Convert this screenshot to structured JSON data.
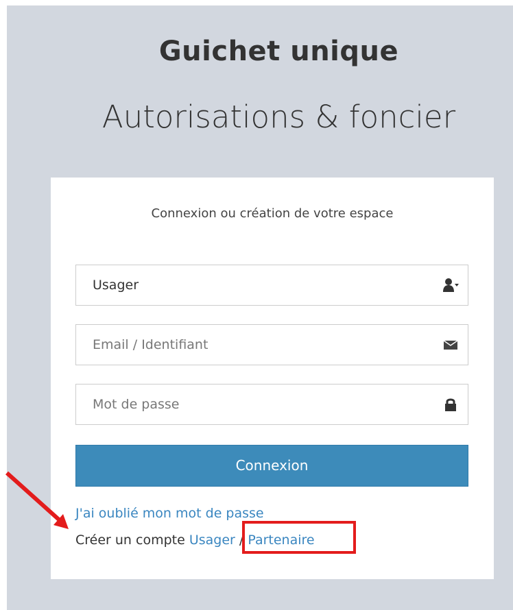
{
  "header": {
    "title": "Guichet unique",
    "subtitle": "Autorisations & foncier"
  },
  "login": {
    "heading": "Connexion ou création de votre espace",
    "user_type": {
      "value": "Usager",
      "icon": "user-dropdown-icon"
    },
    "email": {
      "placeholder": "Email / Identifiant",
      "icon": "envelope-icon"
    },
    "password": {
      "placeholder": "Mot de passe",
      "icon": "lock-icon"
    },
    "submit_label": "Connexion",
    "forgot_label": "J'ai oublié mon mot de passe",
    "create_prefix": "Créer un compte",
    "create_usager": "Usager",
    "create_separator": " / ",
    "create_partenaire": "Partenaire"
  },
  "annotation": {
    "color": "#e31c1c"
  },
  "colors": {
    "background": "#d2d7df",
    "button": "#3d8bba",
    "link": "#3a86c0"
  }
}
